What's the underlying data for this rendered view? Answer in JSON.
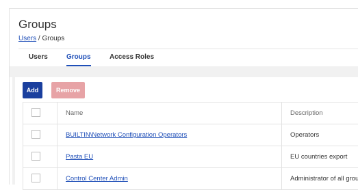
{
  "header": {
    "title": "Groups"
  },
  "breadcrumb": {
    "parent": "Users",
    "separator": "/",
    "current": "Groups"
  },
  "tabs": [
    {
      "label": "Users",
      "active": false
    },
    {
      "label": "Groups",
      "active": true
    },
    {
      "label": "Access Roles",
      "active": false
    }
  ],
  "toolbar": {
    "add_label": "Add",
    "remove_label": "Remove"
  },
  "table": {
    "columns": {
      "name": "Name",
      "description": "Description"
    },
    "rows": [
      {
        "name": "BUILTIN\\Network Configuration Operators",
        "description": "Operators"
      },
      {
        "name": "Pasta EU",
        "description": "EU countries export"
      },
      {
        "name": "Control Center Admin",
        "description": "Administrator of all groups"
      }
    ]
  },
  "colors": {
    "accent": "#1f4fb8",
    "add_button": "#1a3f9e",
    "remove_button_disabled": "#e7a3a6"
  }
}
